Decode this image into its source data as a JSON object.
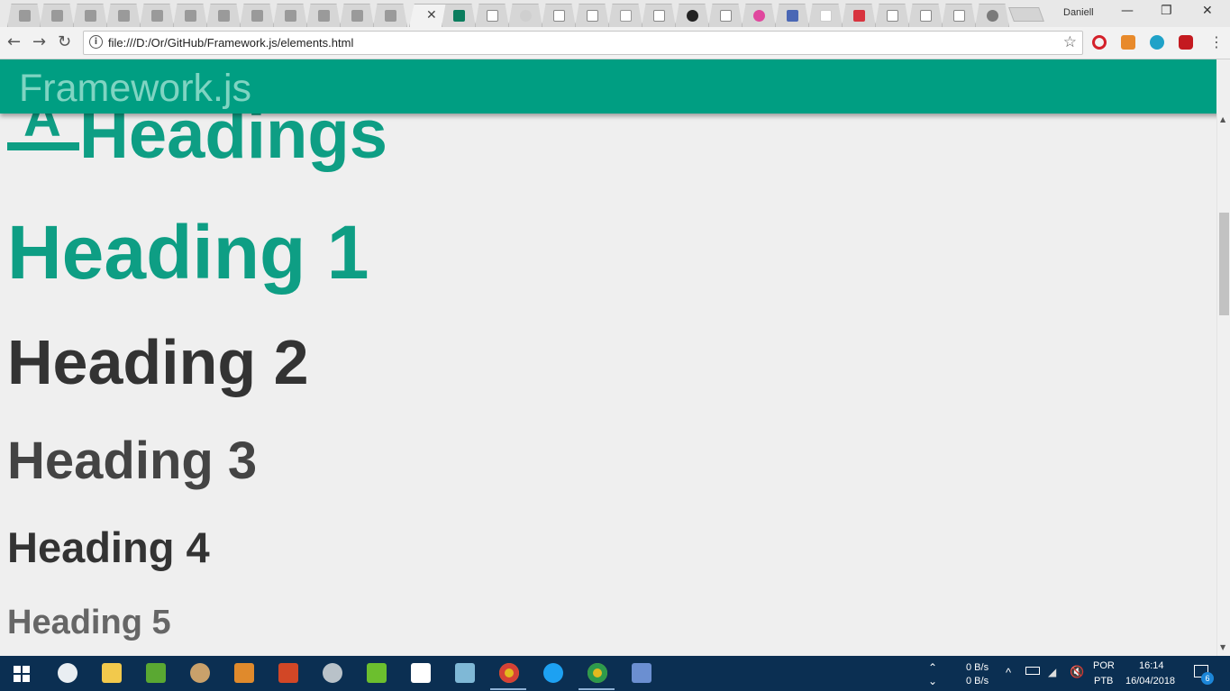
{
  "browser": {
    "user": "Daniell",
    "url": "file:///D:/Or/GitHub/Framework.js/elements.html",
    "tab_close_glyph": "✕",
    "window_controls": [
      "—",
      "❐",
      "✕"
    ],
    "nav": {
      "back": "←",
      "forward": "→",
      "reload": "↻"
    },
    "star_glyph": "☆",
    "menu_glyph": "⋮",
    "info_glyph": "i"
  },
  "app": {
    "brand": "Framework.js"
  },
  "content": {
    "section_icon_letter": "A",
    "section_title": "Headings",
    "headings": [
      "Heading 1",
      "Heading 2",
      "Heading 3",
      "Heading 4",
      "Heading 5"
    ]
  },
  "taskbar": {
    "net_up": "0 B/s",
    "net_down": "0 B/s",
    "lang_top": "POR",
    "lang_bottom": "PTB",
    "time": "16:14",
    "date": "16/04/2018",
    "notifications": "6"
  },
  "colors": {
    "accent": "#009e82",
    "heading_accent": "#0e9e84",
    "taskbar": "#0b2f52"
  }
}
